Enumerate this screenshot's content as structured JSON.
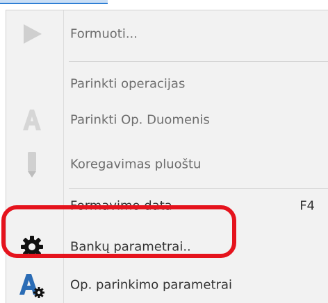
{
  "colors": {
    "menu_bg": "#f2f2f2",
    "text": "#333333",
    "disabled_text": "#6d6d6d",
    "highlight": "#e5131d",
    "a_icon_blue": "#2b6cb5"
  },
  "menu": {
    "items": [
      {
        "label": "Formuoti...",
        "icon": "play-icon",
        "enabled": false
      },
      {
        "label": "Parinkti operacijas",
        "icon": "",
        "enabled": false
      },
      {
        "label": "Parinkti Op. Duomenis",
        "icon": "letter-a-icon",
        "enabled": false
      },
      {
        "label": "Koregavimas pluoštu",
        "icon": "pencil-icon",
        "enabled": false
      },
      {
        "label": "Formavimo data",
        "shortcut": "F4",
        "icon": "",
        "enabled": true
      },
      {
        "label": "Bankų parametrai..",
        "icon": "gear-icon",
        "enabled": true,
        "highlighted": true
      },
      {
        "label": "Op. parinkimo parametrai",
        "icon": "letter-a-gear-icon",
        "enabled": true
      }
    ]
  }
}
